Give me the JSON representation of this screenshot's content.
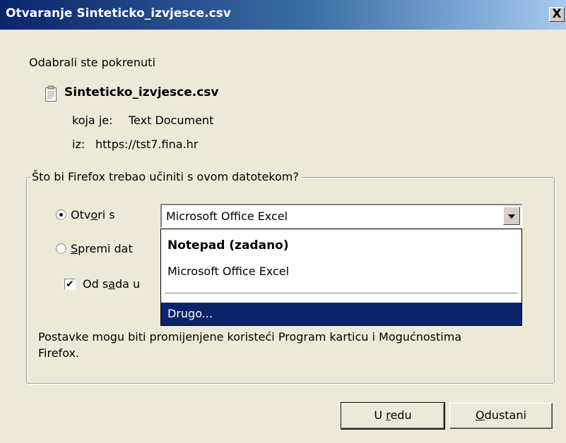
{
  "window": {
    "title": "Otvaranje Sinteticko_izvjesce.csv",
    "close_glyph": "X"
  },
  "intro": "Odabrali ste pokrenuti",
  "file": {
    "name": "Sinteticko_izvjesce.csv",
    "type_label": "koja je:",
    "type_value": "Text Document",
    "from_label": "iz:",
    "from_value": "https://tst7.fina.hr"
  },
  "group": {
    "legend": "Što bi Firefox trebao učiniti s ovom datotekom?",
    "open_with": {
      "pre": "Otv",
      "accel": "o",
      "post": "ri s",
      "checked": true
    },
    "save": {
      "accel": "S",
      "post": "premi dat",
      "checked": false
    },
    "remember": {
      "pre": "Od s",
      "accel": "a",
      "post": "da u",
      "checked": true
    },
    "combo_value": "Microsoft Office Excel",
    "dropdown": {
      "items": [
        "Notepad (zadano)",
        "Microsoft Office Excel"
      ],
      "other": "Drugo..."
    },
    "note_line1": "Postavke mogu biti promijenjene koristeći Program karticu i Mogućnostima",
    "note_line2": "Firefox."
  },
  "buttons": {
    "ok": {
      "pre": "U ",
      "accel": "r",
      "post": "edu"
    },
    "cancel": {
      "accel": "O",
      "post": "dustani"
    }
  },
  "icons": {
    "file": "text-document-icon",
    "check": "✔"
  },
  "colors": {
    "title_start": "#0a246a",
    "title_end": "#a6caf0",
    "selection": "#0a246a",
    "face": "#ece9d8"
  }
}
